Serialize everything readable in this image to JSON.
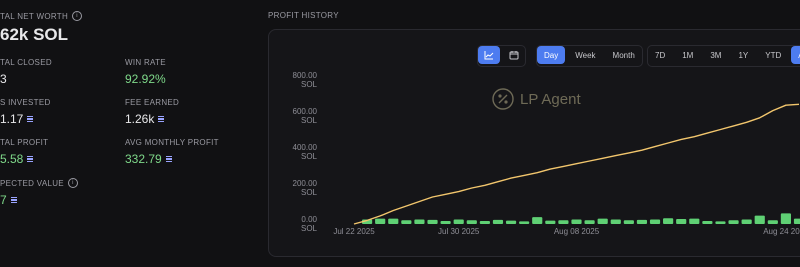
{
  "stats": {
    "net_worth_label": "TAL NET WORTH",
    "net_worth_value": "62k SOL",
    "total_closed_label": "TAL CLOSED",
    "total_closed_value": "3",
    "win_rate_label": "WIN RATE",
    "win_rate_value": "92.92%",
    "invested_label": "S INVESTED",
    "invested_value": "1.17",
    "fee_earned_label": "FEE EARNED",
    "fee_earned_value": "1.26k",
    "total_profit_label": "TAL PROFIT",
    "total_profit_value": "5.58",
    "avg_monthly_label": "AVG MONTHLY PROFIT",
    "avg_monthly_value": "332.79",
    "expected_label": "PECTED VALUE",
    "expected_value": "7"
  },
  "profit_history": {
    "label": "PROFIT HISTORY",
    "watermark": "LP Agent",
    "period_buttons": [
      "Day",
      "Week",
      "Month"
    ],
    "active_period": "Day",
    "range_buttons": [
      "7D",
      "1M",
      "3M",
      "1Y",
      "YTD",
      "ALL"
    ],
    "active_range": "ALL"
  },
  "colors": {
    "accent": "#4d7cf0",
    "line": "#f2c66d",
    "bar": "#5fd074",
    "positive": "#7fd98a"
  },
  "chart_data": {
    "type": "line",
    "y_tick_labels": [
      "800.00\nSOL",
      "600.00\nSOL",
      "400.00\nSOL",
      "200.00\nSOL",
      "0.00\nSOL"
    ],
    "y_ticks": [
      800,
      600,
      400,
      200,
      0
    ],
    "ylim": [
      0,
      800
    ],
    "x_tick_labels": [
      "Jul 22 2025",
      "Jul 30 2025",
      "Aug 08 2025",
      "Aug 24 2025"
    ],
    "x_tick_days": [
      0,
      8,
      17,
      33
    ],
    "x_range_days": [
      0,
      34
    ],
    "cumulative_profit": {
      "x_days": [
        0,
        1,
        2,
        3,
        4,
        5,
        6,
        7,
        8,
        9,
        10,
        11,
        12,
        13,
        14,
        15,
        16,
        17,
        18,
        19,
        20,
        21,
        22,
        23,
        24,
        25,
        26,
        27,
        28,
        29,
        30,
        31,
        32,
        33,
        34
      ],
      "values": [
        0,
        20,
        45,
        75,
        100,
        125,
        150,
        165,
        180,
        200,
        215,
        235,
        255,
        270,
        285,
        305,
        320,
        335,
        350,
        365,
        380,
        395,
        410,
        430,
        450,
        470,
        485,
        505,
        525,
        545,
        565,
        590,
        630,
        660,
        665
      ]
    },
    "daily_profit": {
      "x_days": [
        0,
        1,
        2,
        3,
        4,
        5,
        6,
        7,
        8,
        9,
        10,
        11,
        12,
        13,
        14,
        15,
        16,
        17,
        18,
        19,
        20,
        21,
        22,
        23,
        24,
        25,
        26,
        27,
        28,
        29,
        30,
        31,
        32,
        33,
        34
      ],
      "values": [
        0,
        12,
        14,
        14,
        10,
        12,
        11,
        8,
        12,
        10,
        8,
        11,
        9,
        7,
        18,
        9,
        10,
        12,
        10,
        14,
        12,
        10,
        11,
        12,
        15,
        13,
        14,
        8,
        7,
        10,
        12,
        22,
        10,
        28,
        14
      ]
    }
  }
}
